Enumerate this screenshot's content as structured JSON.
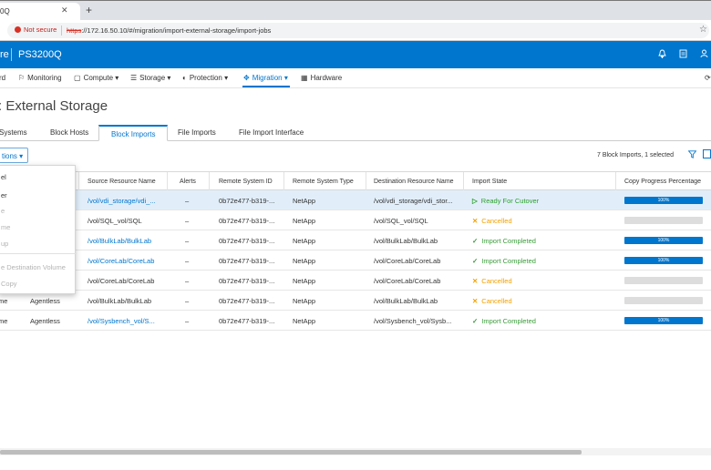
{
  "browser": {
    "tab_title": "0Q",
    "tab_close": "✕",
    "new_tab": "+",
    "security_label": "Not secure",
    "url_scheme": "https",
    "url_rest": "://172.16.50.10/#/migration/import-external-storage/import-jobs"
  },
  "app": {
    "brand": "re",
    "system_name": "PS3200Q",
    "header_icons": [
      "bell-icon",
      "document-icon",
      "user-icon"
    ]
  },
  "nav": {
    "items": [
      {
        "label": "rd",
        "icon": ""
      },
      {
        "label": "Monitoring",
        "icon": "⚐"
      },
      {
        "label": "Compute ▾",
        "icon": "▢"
      },
      {
        "label": "Storage ▾",
        "icon": "☰"
      },
      {
        "label": "Protection ▾",
        "icon": "◐"
      },
      {
        "label": "Migration ▾",
        "icon": "✥"
      },
      {
        "label": "Hardware",
        "icon": "▦"
      }
    ],
    "active": "Migration ▾"
  },
  "page": {
    "title": ": External Storage"
  },
  "subtabs": [
    "Systems",
    "Block Hosts",
    "Block Imports",
    "File Imports",
    "File Import Interface"
  ],
  "active_subtab": "Block Imports",
  "toolbar": {
    "more_actions_label": "tions ▾",
    "count_text": "7 Block Imports, 1 selected"
  },
  "table": {
    "columns": [
      "Source Resource Name",
      "Alerts",
      "Remote System ID",
      "Remote System Type",
      "Destination Resource Name",
      "Import State",
      "Copy Progress Percentage"
    ],
    "rows": [
      {
        "c0": "",
        "c1": "",
        "source": "/vol/vdi_storage/vdi_...",
        "alerts": "–",
        "remote_id": "0b72e477-b319-...",
        "type": "NetApp",
        "dest": "/vol/vdi_storage/vdi_stor...",
        "state": "Ready For Cutover",
        "state_kind": "ready",
        "progress": 100,
        "progress_label": "100%",
        "source_link": true,
        "selected": true
      },
      {
        "c0": "",
        "c1": "",
        "source": "/vol/SQL_vol/SQL",
        "alerts": "–",
        "remote_id": "0b72e477-b319-...",
        "type": "NetApp",
        "dest": "/vol/SQL_vol/SQL",
        "state": "Cancelled",
        "state_kind": "cancel",
        "progress": 0,
        "progress_label": "",
        "source_link": false,
        "selected": false
      },
      {
        "c0": "",
        "c1": "",
        "source": "/vol/BulkLab/BulkLab",
        "alerts": "–",
        "remote_id": "0b72e477-b319-...",
        "type": "NetApp",
        "dest": "/vol/BulkLab/BulkLab",
        "state": "Import Completed",
        "state_kind": "done",
        "progress": 100,
        "progress_label": "100%",
        "source_link": true,
        "selected": false
      },
      {
        "c0": "",
        "c1": "",
        "source": "/vol/CoreLab/CoreLab",
        "alerts": "–",
        "remote_id": "0b72e477-b319-...",
        "type": "NetApp",
        "dest": "/vol/CoreLab/CoreLab",
        "state": "Import Completed",
        "state_kind": "done",
        "progress": 100,
        "progress_label": "100%",
        "source_link": true,
        "selected": false
      },
      {
        "c0": "",
        "c1": "",
        "source": "/vol/CoreLab/CoreLab",
        "alerts": "–",
        "remote_id": "0b72e477-b319-...",
        "type": "NetApp",
        "dest": "/vol/CoreLab/CoreLab",
        "state": "Cancelled",
        "state_kind": "cancel",
        "progress": 0,
        "progress_label": "",
        "source_link": false,
        "selected": false
      },
      {
        "c0": "me",
        "c1": "Agentless",
        "source": "/vol/BulkLab/BulkLab",
        "alerts": "–",
        "remote_id": "0b72e477-b319-...",
        "type": "NetApp",
        "dest": "/vol/BulkLab/BulkLab",
        "state": "Cancelled",
        "state_kind": "cancel",
        "progress": 0,
        "progress_label": "",
        "source_link": false,
        "selected": false
      },
      {
        "c0": "me",
        "c1": "Agentless",
        "source": "/vol/Sysbench_vol/S...",
        "alerts": "–",
        "remote_id": "0b72e477-b319-...",
        "type": "NetApp",
        "dest": "/vol/Sysbench_vol/Sysb...",
        "state": "Import Completed",
        "state_kind": "done",
        "progress": 100,
        "progress_label": "100%",
        "source_link": true,
        "selected": false
      }
    ]
  },
  "menu": {
    "items": [
      {
        "label": "el",
        "disabled": false
      },
      {
        "label": "er",
        "disabled": false
      },
      {
        "label": "e",
        "disabled": true
      },
      {
        "label": "me",
        "disabled": true
      },
      {
        "label": "up",
        "disabled": true
      },
      {
        "label": "e Destination Volume",
        "disabled": true
      },
      {
        "label": "Copy",
        "disabled": true
      }
    ]
  },
  "colors": {
    "brand_blue": "#0076ce",
    "ready": "#2ca02c",
    "cancelled": "#f2a100",
    "completed": "#3a9c3a"
  }
}
